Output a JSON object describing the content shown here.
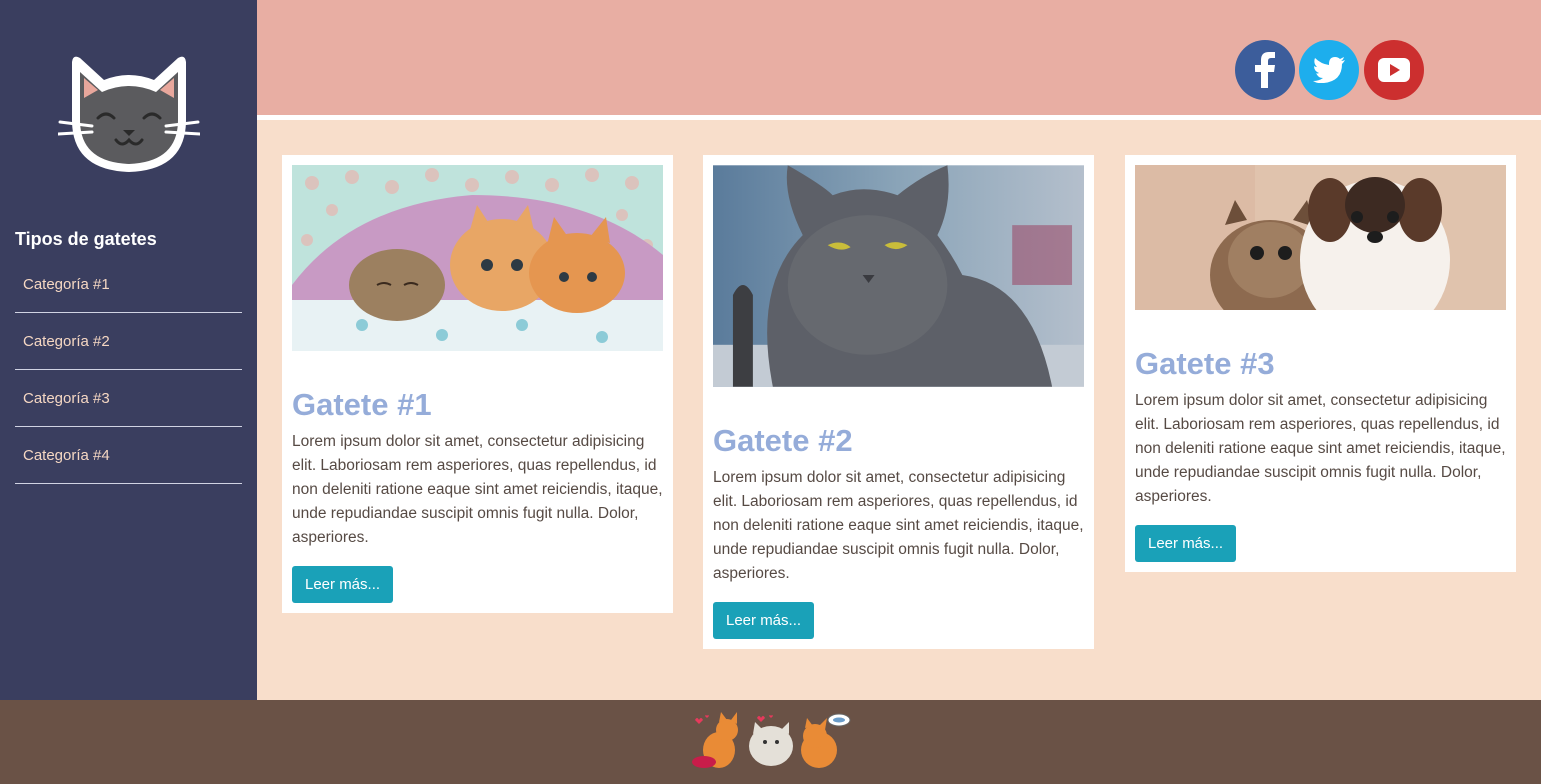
{
  "sidebar": {
    "logo_icon": "cat-face-icon",
    "heading": "Tipos de gatetes",
    "categories": [
      {
        "label": "Categoría #1"
      },
      {
        "label": "Categoría #2"
      },
      {
        "label": "Categoría #3"
      },
      {
        "label": "Categoría #4"
      }
    ]
  },
  "header": {
    "social": [
      {
        "icon": "facebook-icon",
        "color": "#3c5d9b"
      },
      {
        "icon": "twitter-icon",
        "color": "#1daeed"
      },
      {
        "icon": "youtube-icon",
        "color": "#cc2f2f"
      }
    ]
  },
  "cards": [
    {
      "image": "kittens-under-blanket-photo",
      "title": "Gatete #1",
      "text": "Lorem ipsum dolor sit amet, consectetur adipisicing elit. Laboriosam rem asperiores, quas repellendus, id non deleniti ratione eaque sint amet reiciendis, itaque, unde repudiandae suscipit omnis fugit nulla. Dolor, asperiores.",
      "button": "Leer más..."
    },
    {
      "image": "grey-cat-photo",
      "title": "Gatete #2",
      "text": "Lorem ipsum dolor sit amet, consectetur adipisicing elit. Laboriosam rem asperiores, quas repellendus, id non deleniti ratione eaque sint amet reiciendis, itaque, unde repudiandae suscipit omnis fugit nulla. Dolor, asperiores.",
      "button": "Leer más..."
    },
    {
      "image": "cat-and-puppy-photo",
      "title": "Gatete #3",
      "text": "Lorem ipsum dolor sit amet, consectetur adipisicing elit. Laboriosam rem asperiores, quas repellendus, id non deleniti ratione eaque sint amet reiciendis, itaque, unde repudiandae suscipit omnis fugit nulla. Dolor, asperiores.",
      "button": "Leer más..."
    }
  ],
  "footer": {
    "image": "cartoon-cats-icon"
  },
  "colors": {
    "sidebar": "#3a3e5f",
    "header": "#e8aea3",
    "background": "#f8decb",
    "footer": "#6a5246",
    "title": "#95acd9",
    "button": "#1aa1b8"
  }
}
